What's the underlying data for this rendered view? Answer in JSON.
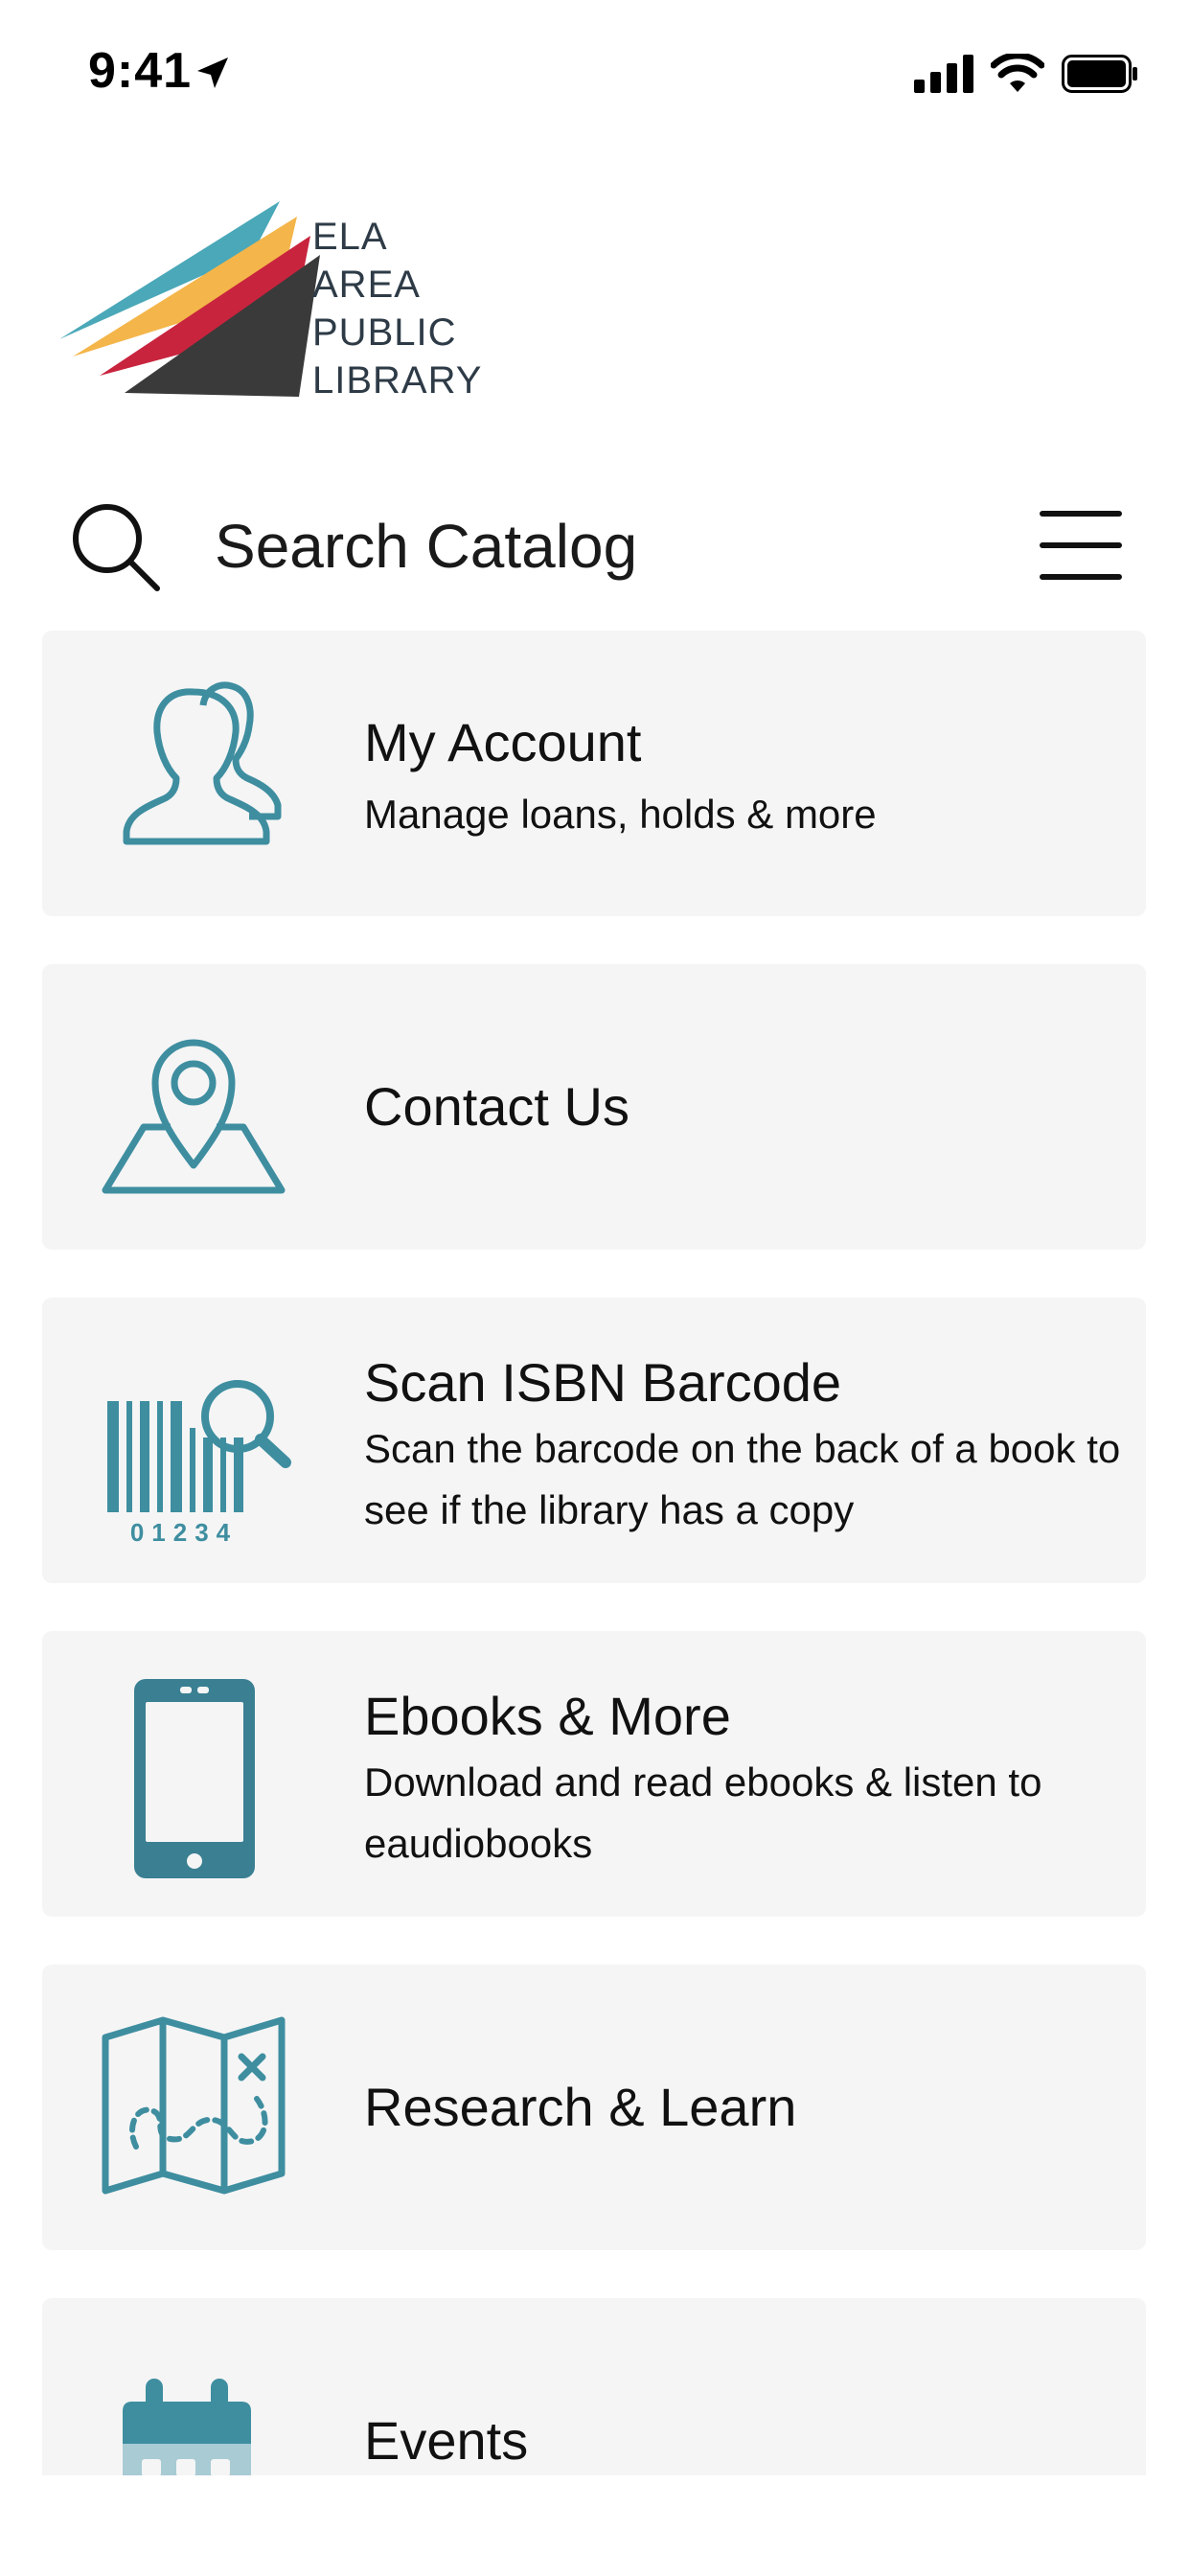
{
  "status_bar": {
    "time": "9:41"
  },
  "logo": {
    "lines": [
      "ELA",
      "AREA",
      "PUBLIC",
      "LIBRARY"
    ]
  },
  "search": {
    "placeholder": "Search Catalog"
  },
  "menu": [
    {
      "title": "My Account",
      "subtitle": "Manage loans, holds & more",
      "icon": "users-icon"
    },
    {
      "title": "Contact Us",
      "subtitle": "",
      "icon": "map-pin-icon"
    },
    {
      "title": "Scan ISBN Barcode",
      "subtitle": "Scan the barcode on the back of a book to see if the library has a copy",
      "icon": "barcode-scan-icon",
      "barcode_digits": "01234"
    },
    {
      "title": "Ebooks & More",
      "subtitle": "Download and read ebooks & listen to eaudiobooks",
      "icon": "smartphone-icon"
    },
    {
      "title": "Research & Learn",
      "subtitle": "",
      "icon": "treasure-map-icon"
    },
    {
      "title": "Events",
      "subtitle": "",
      "icon": "calendar-icon"
    }
  ],
  "colors": {
    "accent": "#3e8ea0",
    "accent_dark": "#3a7f92",
    "accent_light": "#a8cbd4",
    "card_bg": "#f5f5f5",
    "logo_teal": "#4aa8b8",
    "logo_yellow": "#f4b54a",
    "logo_red": "#c8243e",
    "logo_dark": "#3a3a3a"
  }
}
